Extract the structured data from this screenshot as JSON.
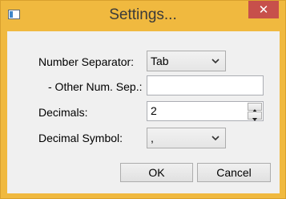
{
  "window": {
    "title": "Settings...",
    "close_label": "✕"
  },
  "fields": {
    "number_separator": {
      "label": "Number Separator:",
      "value": "Tab"
    },
    "other_sep": {
      "label": "- Other Num. Sep.:",
      "value": ""
    },
    "decimals": {
      "label": "Decimals:",
      "value": "2"
    },
    "decimal_symbol": {
      "label": "Decimal Symbol:",
      "value": ","
    }
  },
  "buttons": {
    "ok": "OK",
    "cancel": "Cancel"
  },
  "colors": {
    "frame": "#f0b93f",
    "close": "#c7504b",
    "client": "#f0f0f0"
  },
  "icons": [
    "app-icon",
    "close-icon",
    "chevron-down-icon",
    "spin-up-icon",
    "spin-down-icon"
  ]
}
